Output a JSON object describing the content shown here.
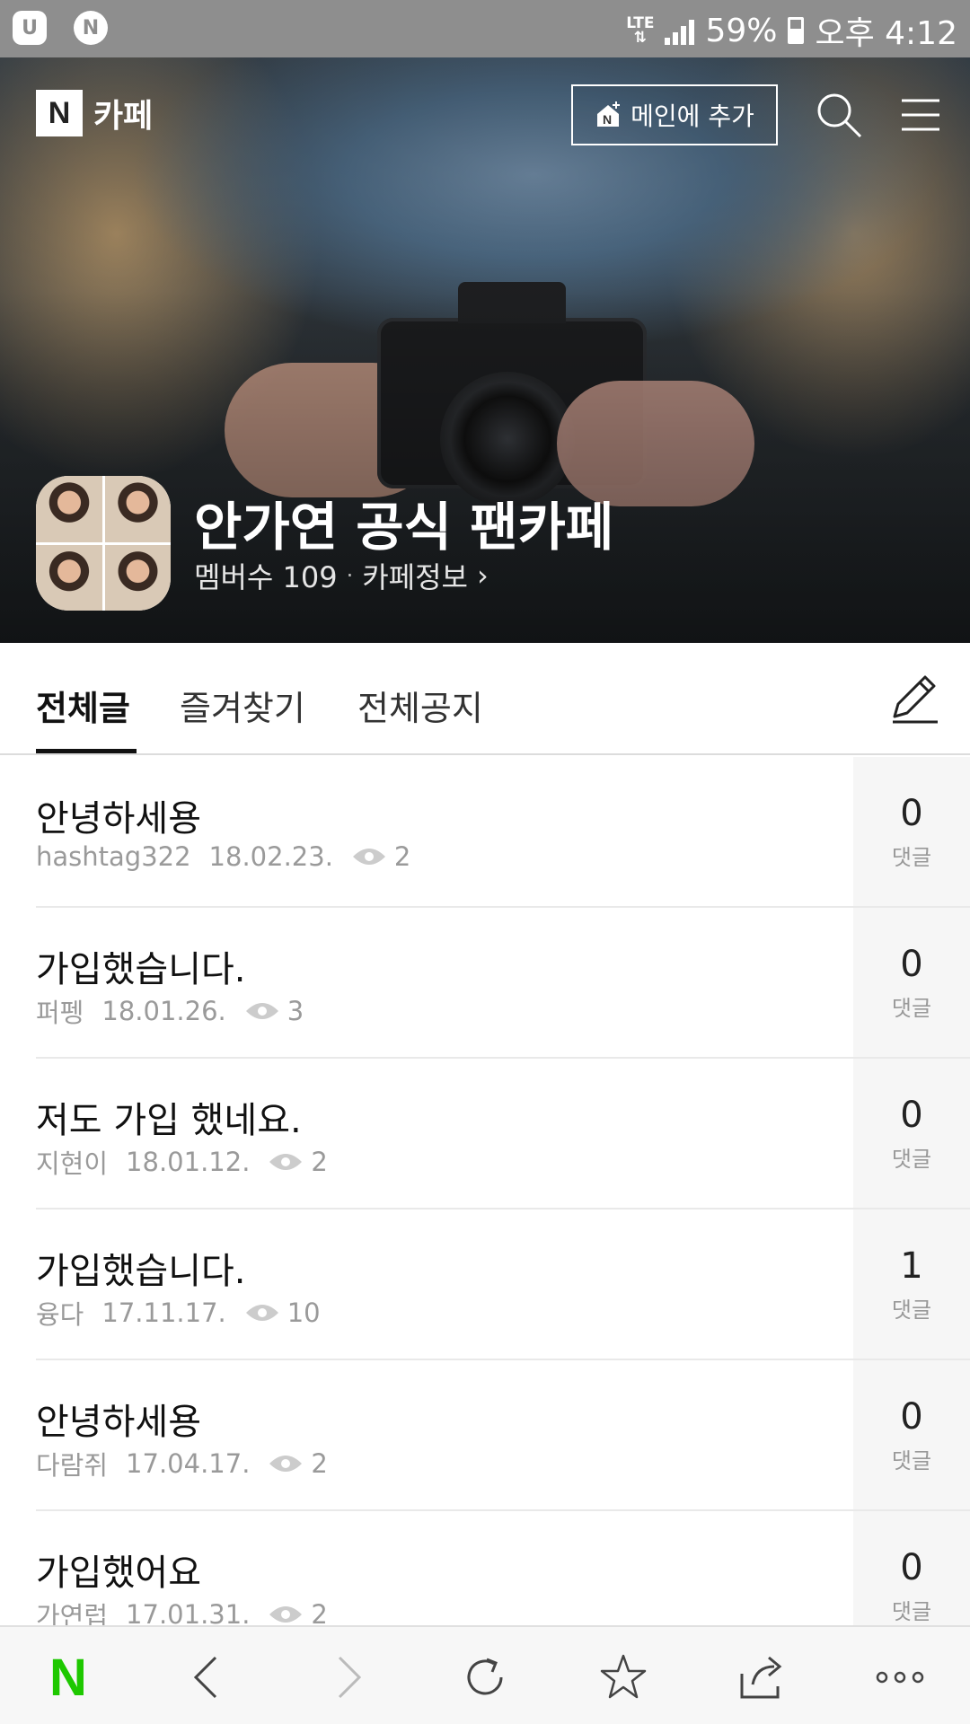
{
  "status_bar": {
    "network": "LTE",
    "battery": "59%",
    "time": "오후 4:12",
    "left_icons": [
      "u-plus-icon",
      "naver-n-icon"
    ]
  },
  "header": {
    "logo_letter": "N",
    "logo_text": "카페",
    "add_main_label": "메인에 추가"
  },
  "cafe": {
    "title": "안가연 공식 팬카페",
    "members_label": "멤버수 109",
    "info_label": "카페정보",
    "info_arrow": "›"
  },
  "tabs": [
    {
      "label": "전체글",
      "active": true
    },
    {
      "label": "즐겨찾기",
      "active": false
    },
    {
      "label": "전체공지",
      "active": false
    }
  ],
  "comment_label": "댓글",
  "posts": [
    {
      "title": "안녕하세용",
      "author": "hashtag322",
      "date": "18.02.23.",
      "views": "2",
      "comments": "0"
    },
    {
      "title": "가입했습니다.",
      "author": "퍼펭",
      "date": "18.01.26.",
      "views": "3",
      "comments": "0"
    },
    {
      "title": "저도 가입 했네요.",
      "author": "지현이",
      "date": "18.01.12.",
      "views": "2",
      "comments": "0"
    },
    {
      "title": "가입했습니다.",
      "author": "융다",
      "date": "17.11.17.",
      "views": "10",
      "comments": "1"
    },
    {
      "title": "안녕하세용",
      "author": "다람쥐",
      "date": "17.04.17.",
      "views": "2",
      "comments": "0"
    },
    {
      "title": "가입했어요",
      "author": "가연럽",
      "date": "17.01.31.",
      "views": "2",
      "comments": "0"
    }
  ],
  "bottom_bar": {
    "home_letter": "N",
    "icons": [
      "naver-home-icon",
      "back-icon",
      "forward-icon",
      "refresh-icon",
      "bookmark-star-icon",
      "share-icon",
      "more-icon"
    ]
  },
  "colors": {
    "naver_green": "#1ec800",
    "status_bar": "#8e8e8e",
    "comment_bg": "#f6f6f6"
  }
}
